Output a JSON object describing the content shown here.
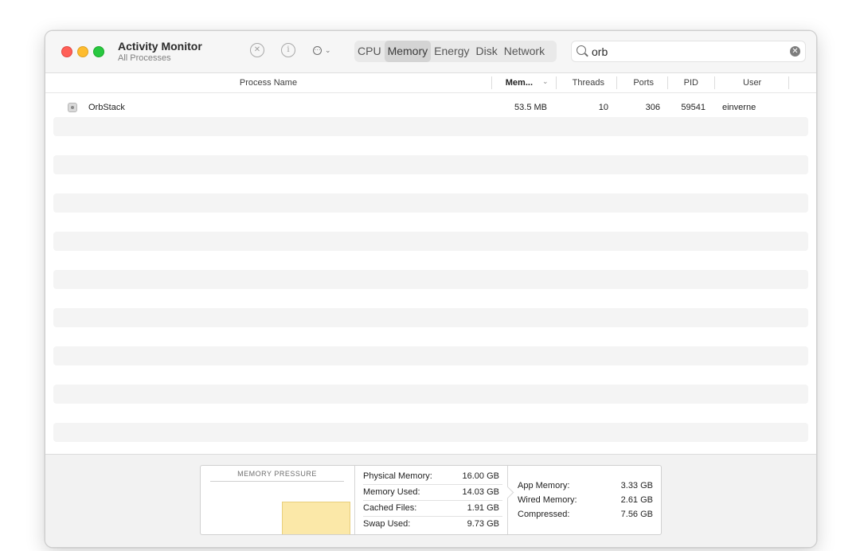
{
  "window": {
    "title": "Activity Monitor",
    "subtitle": "All Processes"
  },
  "toolbar": {
    "tabs": [
      "CPU",
      "Memory",
      "Energy",
      "Disk",
      "Network"
    ],
    "active_tab": "Memory",
    "search": {
      "value": "orb"
    },
    "icons": {
      "stop": "stop-process-icon",
      "info": "info-icon",
      "more": "more-options-icon"
    }
  },
  "table": {
    "columns": [
      "Process Name",
      "Mem...",
      "Threads",
      "Ports",
      "PID",
      "User"
    ],
    "sort_column": "Mem...",
    "rows": [
      {
        "name": "OrbStack",
        "memory": "53.5 MB",
        "threads": "10",
        "ports": "306",
        "pid": "59541",
        "user": "einverne"
      }
    ]
  },
  "memory_panel": {
    "pressure_label": "MEMORY PRESSURE",
    "stats": [
      {
        "label": "Physical Memory:",
        "value": "16.00 GB"
      },
      {
        "label": "Memory Used:",
        "value": "14.03 GB"
      },
      {
        "label": "Cached Files:",
        "value": "1.91 GB"
      },
      {
        "label": "Swap Used:",
        "value": "9.73 GB"
      }
    ],
    "breakdown": [
      {
        "label": "App Memory:",
        "value": "3.33 GB"
      },
      {
        "label": "Wired Memory:",
        "value": "2.61 GB"
      },
      {
        "label": "Compressed:",
        "value": "7.56 GB"
      }
    ]
  },
  "colors": {
    "close": "#ff5f57",
    "minimize": "#febc2e",
    "zoom": "#28c840",
    "pressure_fill": "#fbe8a8"
  }
}
